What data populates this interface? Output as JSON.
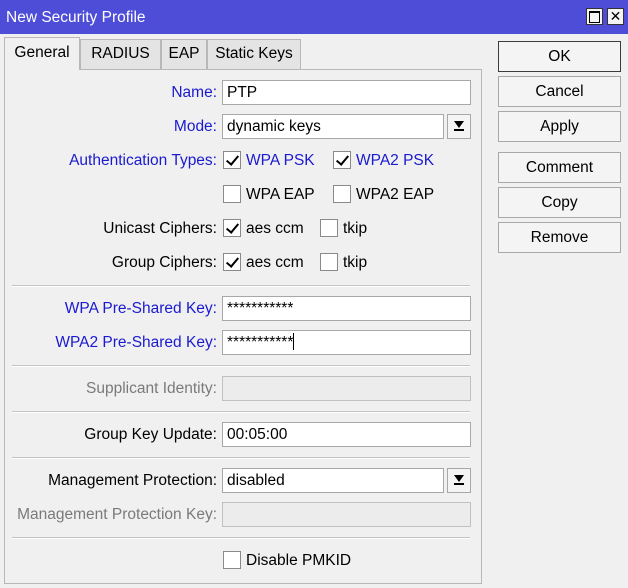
{
  "window": {
    "title": "New Security Profile",
    "close_glyph": "✕"
  },
  "tabs": [
    "General",
    "RADIUS",
    "EAP",
    "Static Keys"
  ],
  "form": {
    "name_label": "Name:",
    "name_value": "PTP",
    "mode_label": "Mode:",
    "mode_value": "dynamic keys",
    "auth_label": "Authentication Types:",
    "auth": [
      {
        "label": "WPA PSK",
        "checked": true
      },
      {
        "label": "WPA2 PSK",
        "checked": true
      },
      {
        "label": "WPA EAP",
        "checked": false
      },
      {
        "label": "WPA2 EAP",
        "checked": false
      }
    ],
    "unicast_label": "Unicast Ciphers:",
    "unicast": [
      {
        "label": "aes ccm",
        "checked": true
      },
      {
        "label": "tkip",
        "checked": false
      }
    ],
    "group_label": "Group Ciphers:",
    "group": [
      {
        "label": "aes ccm",
        "checked": true
      },
      {
        "label": "tkip",
        "checked": false
      }
    ],
    "wpa_psk_label": "WPA Pre-Shared Key:",
    "wpa_psk_value": "***********",
    "wpa2_psk_label": "WPA2 Pre-Shared Key:",
    "wpa2_psk_value": "***********",
    "supplicant_label": "Supplicant Identity:",
    "supplicant_value": "",
    "gku_label": "Group Key Update:",
    "gku_value": "00:05:00",
    "mgmt_label": "Management Protection:",
    "mgmt_value": "disabled",
    "mgmt_key_label": "Management Protection Key:",
    "mgmt_key_value": "",
    "pmkid_label": "Disable PMKID",
    "pmkid_checked": false
  },
  "buttons": [
    "OK",
    "Cancel",
    "Apply",
    "Comment",
    "Copy",
    "Remove"
  ],
  "colors": {
    "titlebar": "#4d4dd8",
    "label_blue": "#1a1ad0",
    "label_gray": "#7a7a7a",
    "panel": "#f0f0f0"
  }
}
